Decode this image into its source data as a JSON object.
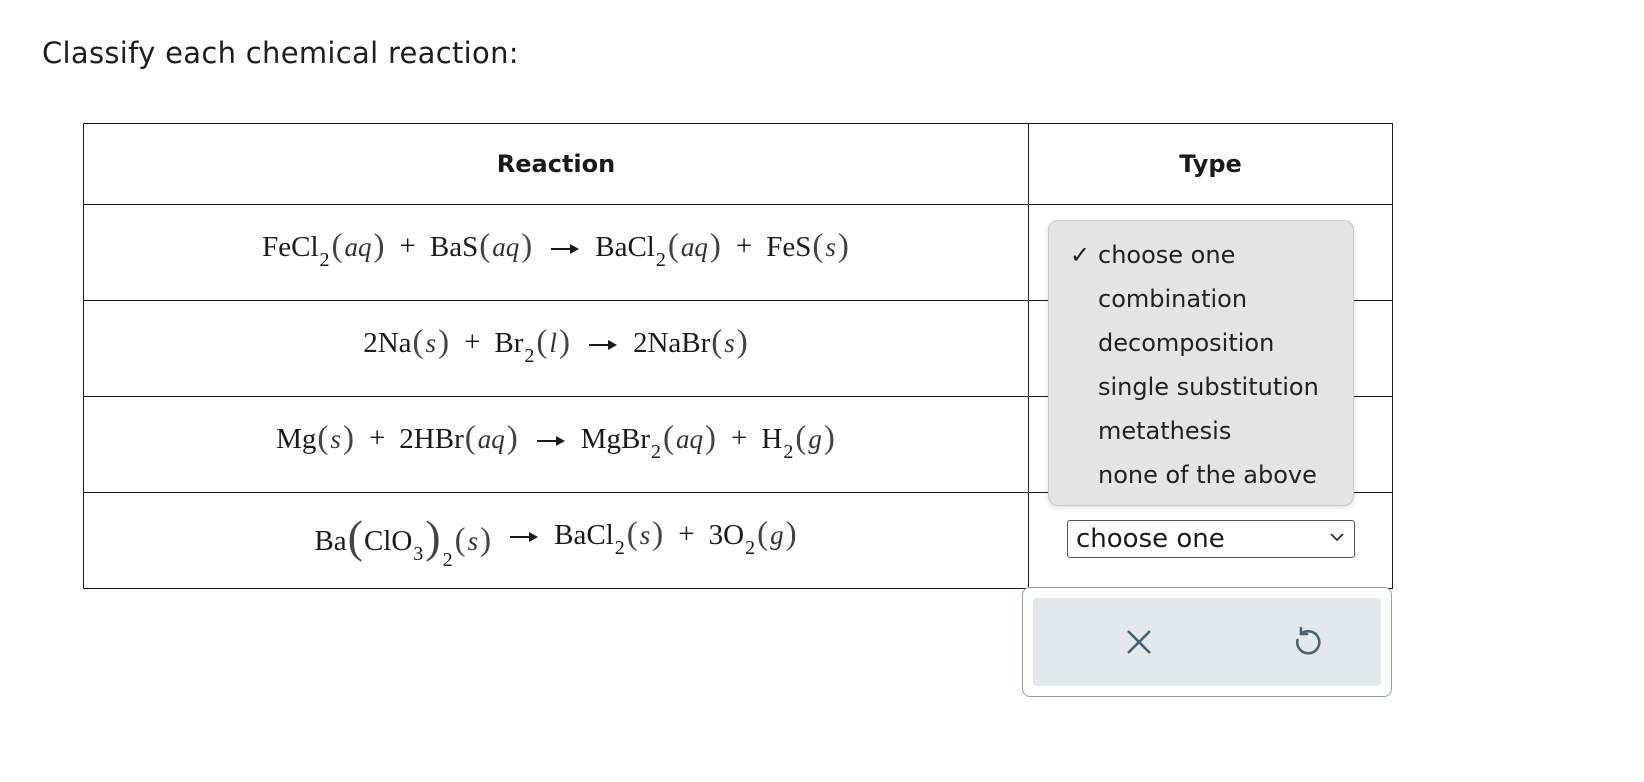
{
  "prompt": "Classify each chemical reaction:",
  "table": {
    "headers": {
      "reaction": "Reaction",
      "type": "Type"
    }
  },
  "reactions": [
    {
      "r1": {
        "formula": "FeCl",
        "sub": "2",
        "state": "aq"
      },
      "r2": {
        "formula": "BaS",
        "state": "aq"
      },
      "p1": {
        "formula": "BaCl",
        "sub": "2",
        "state": "aq"
      },
      "p2": {
        "formula": "FeS",
        "state": "s"
      }
    },
    {
      "r1": {
        "formula": "2Na",
        "state": "s"
      },
      "r2": {
        "formula": "Br",
        "sub": "2",
        "state": "l"
      },
      "p1": {
        "formula": "2NaBr",
        "state": "s"
      }
    },
    {
      "r1": {
        "formula": "Mg",
        "state": "s"
      },
      "r2": {
        "formula": "2HBr",
        "state": "aq"
      },
      "p1": {
        "formula": "MgBr",
        "sub": "2",
        "state": "aq"
      },
      "p2": {
        "formula": "H",
        "sub": "2",
        "state": "g"
      }
    },
    {
      "r1": {
        "formula": "Ba",
        "inner": "ClO",
        "innerSub": "3",
        "outerSub": "2",
        "state": "s"
      },
      "p1": {
        "formula": "BaCl",
        "sub": "2",
        "state": "s"
      },
      "p2": {
        "formula": "3O",
        "sub": "2",
        "state": "g"
      }
    }
  ],
  "plus": "+",
  "select": {
    "value": "choose one",
    "icon": "chevron-down-icon"
  },
  "dropdown": {
    "selected_index": 0,
    "check_glyph": "✓",
    "options": [
      "choose one",
      "combination",
      "decomposition",
      "single substitution",
      "metathesis",
      "none of the above"
    ]
  },
  "toolbar": {
    "clear_icon": "close-icon",
    "undo_icon": "undo-icon",
    "icon_color": "#4a6270"
  }
}
